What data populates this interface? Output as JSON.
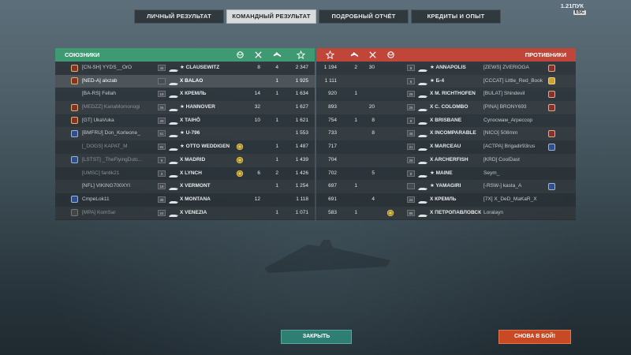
{
  "version": "1.21ПУК",
  "esc_label": "ESC",
  "tabs": [
    "ЛИЧНЫЙ РЕЗУЛЬТАТ",
    "КОМАНДНЫЙ РЕЗУЛЬТАТ",
    "ПОДРОБНЫЙ ОТЧЁТ",
    "КРЕДИТЫ И ОПЫТ"
  ],
  "active_tab": 1,
  "allies": {
    "title": "СОЮЗНИКИ",
    "columns": [
      "medal-icon",
      "kills-icon",
      "planes-icon",
      "xp-star-icon"
    ],
    "rows": [
      {
        "player": "[CN-SH] YYDS__OrO",
        "tier": "45",
        "ship": "★ CLAUSEWITZ",
        "medal": false,
        "kills": "8",
        "planes": "4",
        "xp": "2 347",
        "dim": false,
        "badge": "red",
        "highlight": false
      },
      {
        "player": "[NED-A] alxzab",
        "tier": "",
        "ship": "X BALAO",
        "medal": false,
        "kills": "",
        "planes": "1",
        "xp": "1 925",
        "dim": false,
        "badge": "red",
        "highlight": true
      },
      {
        "player": "[BA-RS] Fellah",
        "tier": "19",
        "ship": "X КРЕМЛЬ",
        "medal": false,
        "kills": "14",
        "planes": "1",
        "xp": "1 634",
        "dim": false,
        "badge": "",
        "highlight": false
      },
      {
        "player": "[MEDZZ] KanaMomonogi",
        "tier": "26",
        "ship": "★ HANNOVER",
        "medal": false,
        "kills": "32",
        "planes": "",
        "xp": "1 627",
        "dim": true,
        "badge": "red",
        "highlight": false
      },
      {
        "player": "[GT] UkaVuka",
        "tier": "29",
        "ship": "X TAIHŌ",
        "medal": false,
        "kills": "10",
        "planes": "1",
        "xp": "1 621",
        "dim": false,
        "badge": "red",
        "highlight": false
      },
      {
        "player": "[BMFRU] Don_Korleone_",
        "tier": "51",
        "ship": "★ U-796",
        "medal": false,
        "kills": "",
        "planes": "",
        "xp": "1 553",
        "dim": false,
        "badge": "blue",
        "highlight": false
      },
      {
        "player": "[_DOGS] KAPAT_M",
        "tier": "84",
        "ship": "★ OTTO WEDDIGEN",
        "medal": true,
        "kills": "",
        "planes": "1",
        "xp": "1 487",
        "dim": true,
        "badge": "",
        "highlight": false
      },
      {
        "player": "[LSTST] _TheFlyingDutc...",
        "tier": "9",
        "ship": "X MADRID",
        "medal": true,
        "kills": "",
        "planes": "1",
        "xp": "1 439",
        "dim": true,
        "badge": "blue",
        "highlight": false
      },
      {
        "player": "[UMSC] fantik21",
        "tier": "3",
        "ship": "X LYNCH",
        "medal": true,
        "kills": "6",
        "planes": "2",
        "xp": "1 426",
        "dim": true,
        "badge": "",
        "highlight": false
      },
      {
        "player": "[NFL] VIKING700XYI",
        "tier": "18",
        "ship": "X VERMONT",
        "medal": false,
        "kills": "",
        "planes": "1",
        "xp": "1 254",
        "dim": false,
        "badge": "",
        "highlight": false
      },
      {
        "player": "CmpeLok11",
        "tier": "38",
        "ship": "X MONTANA",
        "medal": false,
        "kills": "12",
        "planes": "",
        "xp": "1 118",
        "dim": false,
        "badge": "blue",
        "highlight": false
      },
      {
        "player": "[MPA] KomSar",
        "tier": "24",
        "ship": "X VENEZIA",
        "medal": false,
        "kills": "",
        "planes": "1",
        "xp": "1 071",
        "dim": true,
        "badge": "gray",
        "highlight": false
      }
    ]
  },
  "enemies": {
    "title": "ПРОТИВНИКИ",
    "columns": [
      "xp-star-icon",
      "planes-icon",
      "kills-icon",
      "medal-icon"
    ],
    "rows": [
      {
        "xp": "1 194",
        "planes": "2",
        "kills": "30",
        "medal": false,
        "tier": "8",
        "ship": "★ ANNAPOLIS",
        "player": "[ZEWS] ZVERIOGA",
        "dim": false,
        "badge": "red"
      },
      {
        "xp": "1 111",
        "planes": "",
        "kills": "",
        "medal": false,
        "tier": "6",
        "ship": "★ Б-4",
        "player": "[CCCAT] Little_Red_Book",
        "dim": false,
        "badge": "gold"
      },
      {
        "xp": "920",
        "planes": "1",
        "kills": "",
        "medal": false,
        "tier": "28",
        "ship": "X M. RICHTHOFEN",
        "player": "[BULAT] Shindevil",
        "dim": false,
        "badge": "red"
      },
      {
        "xp": "893",
        "planes": "",
        "kills": "20",
        "medal": false,
        "tier": "26",
        "ship": "X C. COLOMBO",
        "player": "[PINA] BRONY693",
        "dim": false,
        "badge": "red"
      },
      {
        "xp": "754",
        "planes": "1",
        "kills": "8",
        "medal": false,
        "tier": "9",
        "ship": "X BRISBANE",
        "player": "Cynocмaм_Arpeccop",
        "dim": false,
        "badge": ""
      },
      {
        "xp": "733",
        "planes": "",
        "kills": "8",
        "medal": false,
        "tier": "48",
        "ship": "X INCOMPARABLE",
        "player": "[NICO] 508mm",
        "dim": false,
        "badge": "red"
      },
      {
        "xp": "717",
        "planes": "",
        "kills": "",
        "medal": false,
        "tier": "21",
        "ship": "X MARCEAU",
        "player": "[ACTPA] Brigadir93rus",
        "dim": false,
        "badge": "blue"
      },
      {
        "xp": "704",
        "planes": "",
        "kills": "",
        "medal": false,
        "tier": "26",
        "ship": "X ARCHERFISH",
        "player": "[KRD] CoolDast",
        "dim": false,
        "badge": ""
      },
      {
        "xp": "702",
        "planes": "",
        "kills": "5",
        "medal": false,
        "tier": "9",
        "ship": "★ MAINE",
        "player": "Seym_",
        "dim": false,
        "badge": ""
      },
      {
        "xp": "697",
        "planes": "1",
        "kills": "",
        "medal": false,
        "tier": "",
        "ship": "★ YAMAGIRI",
        "player": "[-RSW-] kasta_A",
        "dim": false,
        "badge": "blue"
      },
      {
        "xp": "691",
        "planes": "",
        "kills": "4",
        "medal": false,
        "tier": "24",
        "ship": "X КРЕМЛЬ",
        "player": "[7X] X_DeD_MaKaR_X",
        "dim": false,
        "badge": ""
      },
      {
        "xp": "583",
        "planes": "1",
        "kills": "",
        "medal": true,
        "tier": "85",
        "ship": "X ПЕТРОПАВЛОВСК",
        "player": "Loralayn",
        "dim": false,
        "badge": ""
      }
    ]
  },
  "buttons": {
    "close": "ЗАКРЫТЬ",
    "again": "СНОВА В БОЙ!"
  }
}
